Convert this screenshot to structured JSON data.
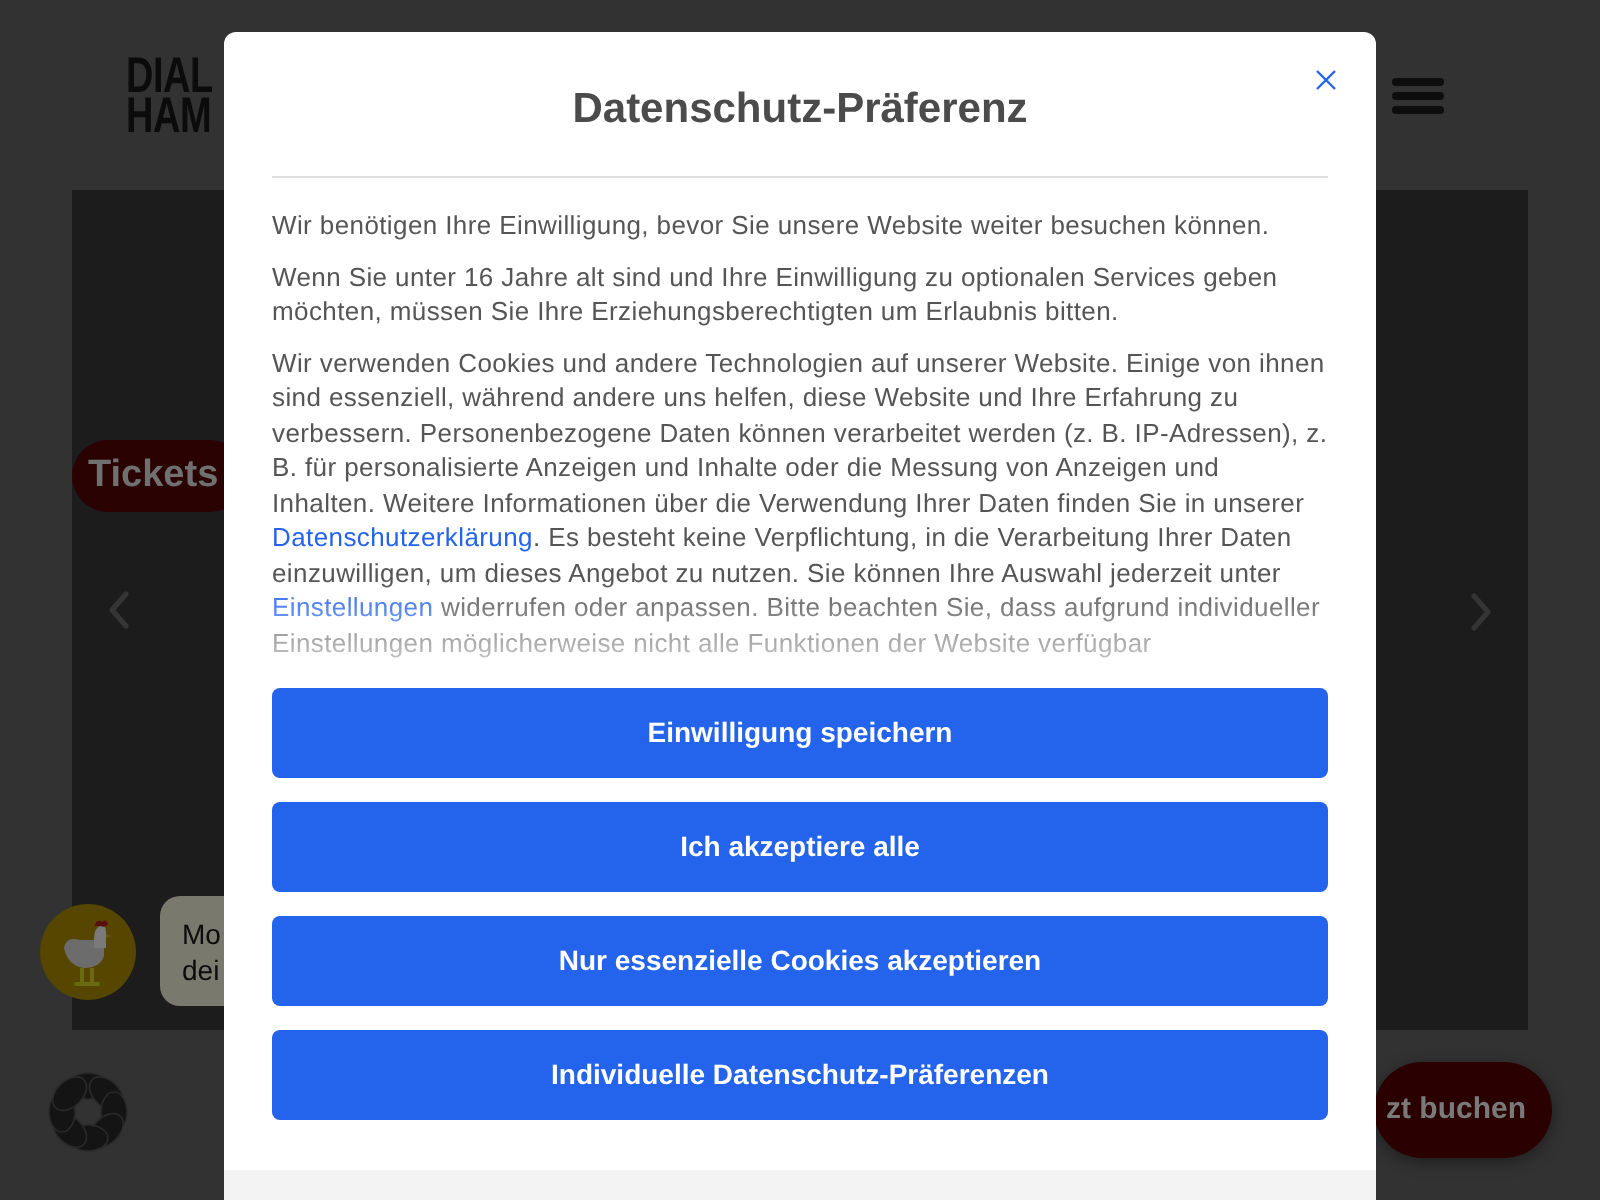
{
  "page": {
    "logo_lines": [
      "DIAL",
      "HAM"
    ],
    "tickets_tab": "Tickets",
    "chat_bubble_lines": [
      "Mo",
      "dei"
    ],
    "book_button": "zt buchen"
  },
  "modal": {
    "title": "Datenschutz-Präferenz",
    "paragraphs": [
      {
        "segments": [
          {
            "kind": "text",
            "text": "Wir benötigen Ihre Einwilligung, bevor Sie unsere Website weiter besuchen können."
          }
        ]
      },
      {
        "segments": [
          {
            "kind": "text",
            "text": "Wenn Sie unter 16 Jahre alt sind und Ihre Einwilligung zu optionalen Services geben möchten, müssen Sie Ihre Erziehungsberechtigten um Erlaubnis bitten."
          }
        ]
      },
      {
        "segments": [
          {
            "kind": "text",
            "text": "Wir verwenden Cookies und andere Technologien auf unserer Website. Einige von ihnen sind essenziell, während andere uns helfen, diese Website und Ihre Erfahrung zu verbessern. Personenbezogene Daten können verarbeitet werden (z. B. IP-Adressen), z. B. für personalisierte Anzeigen und Inhalte oder die Messung von Anzeigen und Inhalten. Weitere Informationen über die Verwendung Ihrer Daten finden Sie in unserer "
          },
          {
            "kind": "link",
            "text": "Datenschutzerklärung"
          },
          {
            "kind": "text",
            "text": ". Es besteht keine Verpflichtung, in die Verarbeitung Ihrer Daten einzuwilligen, um dieses Angebot zu nutzen. Sie können Ihre Auswahl jederzeit unter "
          },
          {
            "kind": "link",
            "text": "Einstellungen"
          },
          {
            "kind": "text",
            "text": " widerrufen oder anpassen. Bitte beachten Sie, dass aufgrund individueller Einstellungen möglicherweise nicht alle Funktionen der Website verfügbar"
          }
        ]
      }
    ],
    "buttons": [
      "Einwilligung speichern",
      "Ich akzeptiere alle",
      "Nur essenzielle Cookies akzeptieren",
      "Individuelle Datenschutz-Präferenzen"
    ]
  }
}
